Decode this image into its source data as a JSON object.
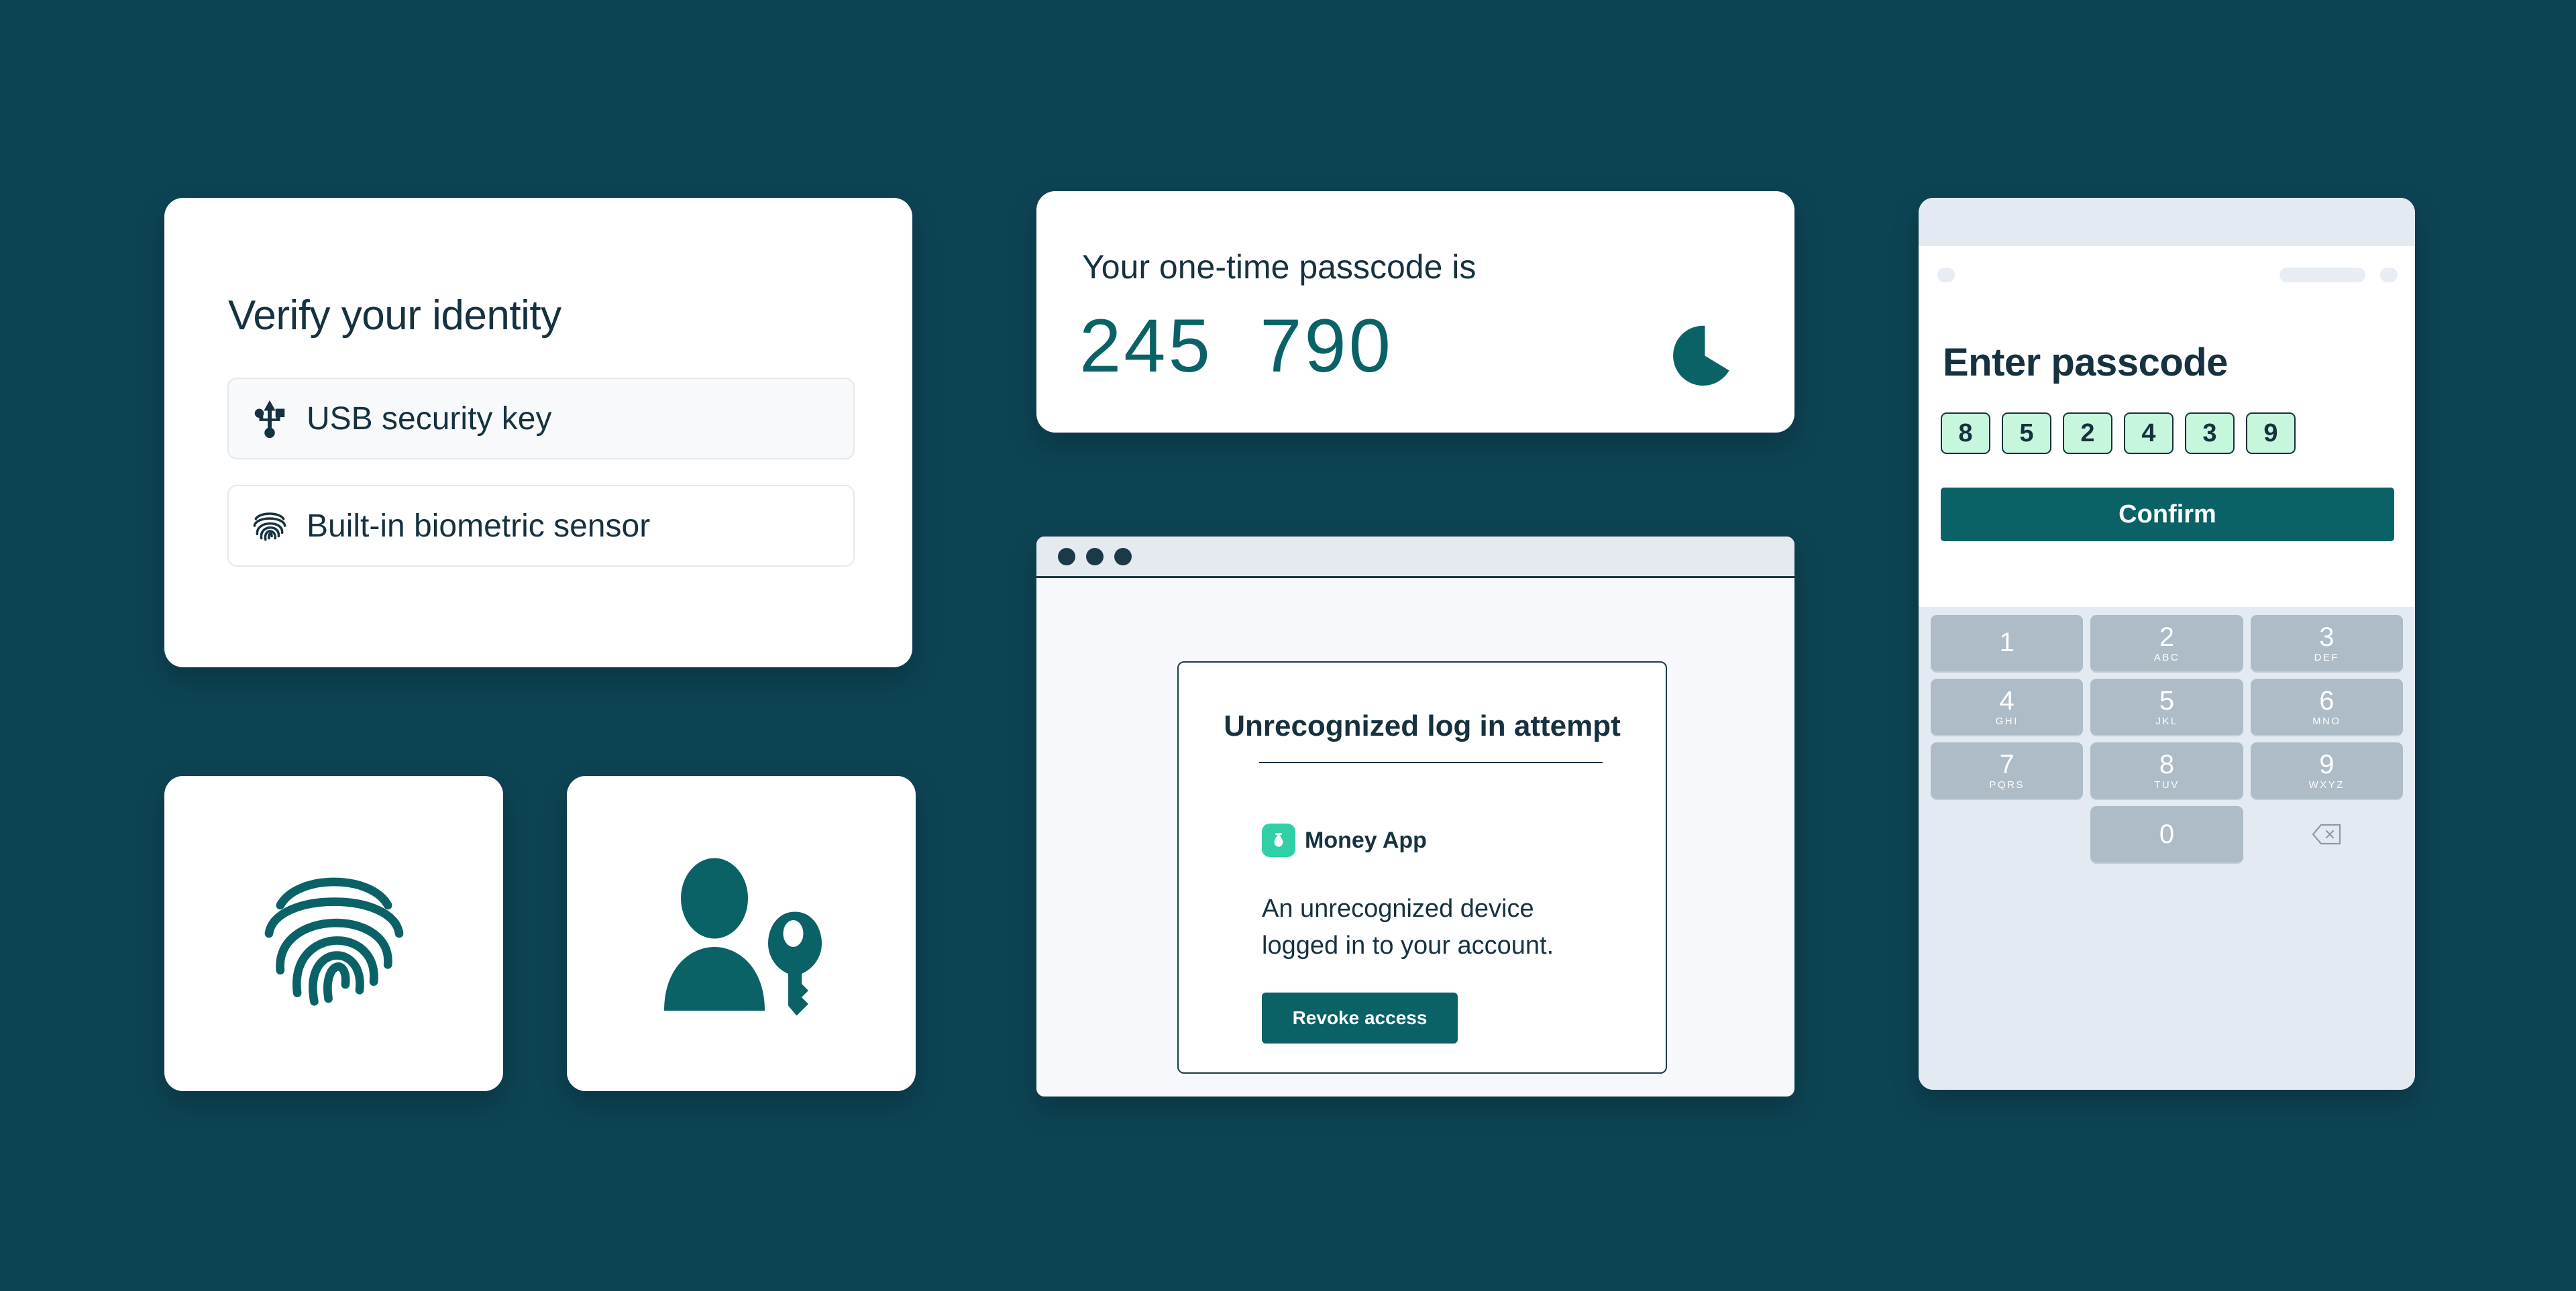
{
  "theme": {
    "page_background": "#0d4454",
    "card_background": "#ffffff",
    "accent_teal": "#0a6266",
    "ink_navy": "#16313f",
    "mint_fill": "#c6f6dc",
    "app_logo_green": "#2fd0a5",
    "keypad_background": "#e4eaf2",
    "key_fill": "#adbcc6"
  },
  "verify_card": {
    "title": "Verify your identity",
    "methods": [
      {
        "icon": "usb-icon",
        "label": "USB security key",
        "selected": true
      },
      {
        "icon": "fingerprint-icon",
        "label": "Built-in biometric sensor",
        "selected": false
      }
    ]
  },
  "icon_cards": [
    {
      "icon": "fingerprint-icon",
      "name": "fingerprint-illustration-card"
    },
    {
      "icon": "user-key-icon",
      "name": "user-key-illustration-card"
    }
  ],
  "otp_card": {
    "label": "Your one-time passcode is",
    "code": "245  790",
    "code_groups": [
      "245",
      "790"
    ],
    "timer_icon": "pie-timer-icon"
  },
  "browser": {
    "window_dots": 3,
    "dialog": {
      "title": "Unrecognized log in attempt",
      "app_logo_icon": "money-bag-icon",
      "app_name": "Money App",
      "body": "An unrecognized device logged in to your account.",
      "primary_button": "Revoke access"
    }
  },
  "phone": {
    "title": "Enter passcode",
    "passcode_digits": [
      "8",
      "5",
      "2",
      "4",
      "3",
      "9"
    ],
    "confirm_label": "Confirm",
    "keypad": [
      {
        "digit": "1",
        "letters": ""
      },
      {
        "digit": "2",
        "letters": "ABC"
      },
      {
        "digit": "3",
        "letters": "DEF"
      },
      {
        "digit": "4",
        "letters": "GHI"
      },
      {
        "digit": "5",
        "letters": "JKL"
      },
      {
        "digit": "6",
        "letters": "MNO"
      },
      {
        "digit": "7",
        "letters": "PQRS"
      },
      {
        "digit": "8",
        "letters": "TUV"
      },
      {
        "digit": "9",
        "letters": "WXYZ"
      },
      {
        "digit": "",
        "letters": ""
      },
      {
        "digit": "0",
        "letters": ""
      },
      {
        "digit": "backspace-icon",
        "letters": ""
      }
    ]
  }
}
